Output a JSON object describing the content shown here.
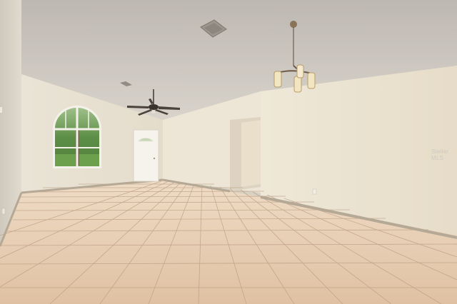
{
  "scene": {
    "type": "photo",
    "subject": "empty-room-interior",
    "colors": {
      "ceiling": "#c9c4bd",
      "wall_light": "#ece4d4",
      "wall_shadow": "#ddd4c2",
      "floor_tile": "#e4c9ac",
      "grout": "#b99b80",
      "baseboard": "#b5a996",
      "window_glass": "#5e8f48"
    }
  },
  "watermark": {
    "text": "Stellar MLS"
  }
}
